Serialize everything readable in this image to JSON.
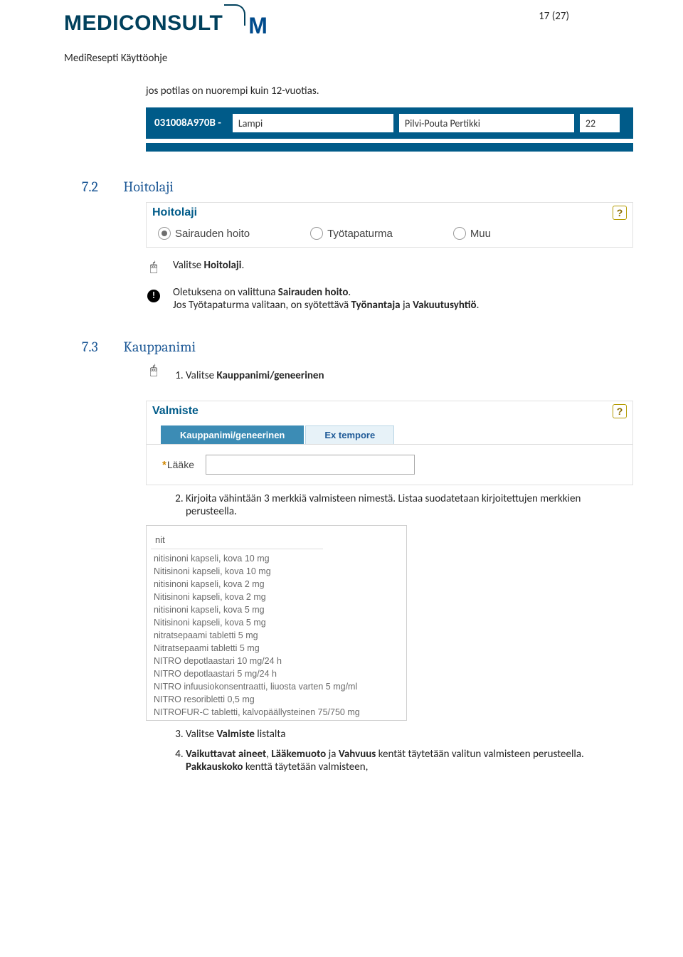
{
  "pageNum": "17 (27)",
  "brand": {
    "name": "MEDICONSULT",
    "markLetter": "M"
  },
  "docTitle": "MediResepti Käyttöohje",
  "intro": "jos potilas on nuorempi kuin 12-vuotias.",
  "patient": {
    "idPrefix": "031008A970B -",
    "surname": "Lampi",
    "firstname": "Pilvi-Pouta Pertikki",
    "age": "22"
  },
  "h72": {
    "num": "7.2",
    "title": "Hoitolaji"
  },
  "hoitolajiPanel": {
    "title": "Hoitolaji",
    "options": [
      "Sairauden hoito",
      "Työtapaturma",
      "Muu"
    ]
  },
  "note1": {
    "before": "Valitse ",
    "bold": "Hoitolaji",
    "after": "."
  },
  "note2": {
    "l1a": "Oletuksena on valittuna ",
    "l1b": "Sairauden hoito",
    "l1c": ".",
    "l2a": "Jos Työtapaturma valitaan, on syötettävä ",
    "l2b1": "Työnantaja",
    "l2mid": " ja ",
    "l2b2": "Vakuutusyhtiö",
    "l2c": "."
  },
  "h73": {
    "num": "7.3",
    "title": "Kauppanimi"
  },
  "valmistePanel": {
    "title": "Valmiste",
    "tabActive": "Kauppanimi/geneerinen",
    "tabInactive": "Ex tempore",
    "fieldReq": "*",
    "fieldLabel": "Lääke",
    "fieldValue": ""
  },
  "step1": {
    "before": "Valitse ",
    "bold": "Kauppanimi/geneerinen"
  },
  "step2": "Kirjoita vähintään 3 merkkiä valmisteen nimestä. Listaa suodatetaan kirjoitettujen merkkien perusteella.",
  "dropdown": {
    "query": "nit",
    "items": [
      "nitisinoni kapseli, kova 10 mg",
      "Nitisinoni kapseli, kova 10 mg",
      "nitisinoni kapseli, kova 2 mg",
      "Nitisinoni kapseli, kova 2 mg",
      "nitisinoni kapseli, kova 5 mg",
      "Nitisinoni kapseli, kova 5 mg",
      "nitratsepaami tabletti 5 mg",
      "Nitratsepaami tabletti 5 mg",
      "NITRO depotlaastari 10 mg/24 h",
      "NITRO depotlaastari 5 mg/24 h",
      "NITRO infuusiokonsentraatti, liuosta varten 5 mg/ml",
      "NITRO resoribletti 0,5 mg",
      "NITROFUR-C tabletti, kalvopäällysteinen 75/750 mg"
    ]
  },
  "step3": {
    "before": "Valitse ",
    "bold": "Valmiste",
    "after": " listalta"
  },
  "step4": {
    "b1": "Vaikuttavat aineet",
    "m1": ", ",
    "b2": "Lääkemuoto",
    "m2": " ja ",
    "b3": "Vahvuus",
    "m3": " kentät täytetään valitun valmisteen perusteella. ",
    "b4": "Pakkauskoko",
    "m4": " kenttä täytetään valmisteen,"
  },
  "helpGlyph": "?"
}
